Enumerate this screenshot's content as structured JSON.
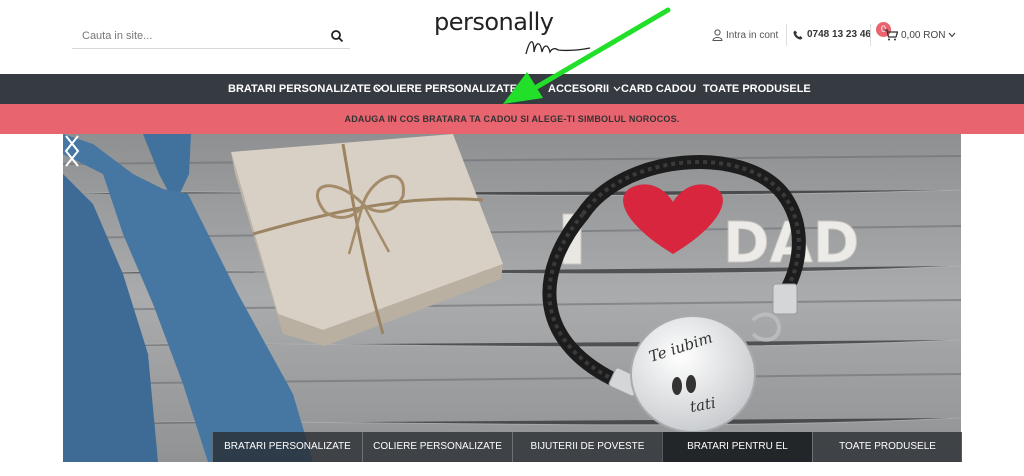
{
  "header": {
    "search_placeholder": "Cauta in site...",
    "logo_text": "personally",
    "account_label": "Intra in cont",
    "phone": "0748 13 23 46",
    "cart_count": "0",
    "cart_total": "0,00 RON"
  },
  "nav": {
    "items": [
      {
        "label": "BRATARI PERSONALIZATE",
        "dropdown": true
      },
      {
        "label": "COLIERE PERSONALIZATE",
        "dropdown": true
      },
      {
        "label": "ACCESORII",
        "dropdown": true
      },
      {
        "label": "CARD CADOU",
        "dropdown": false
      },
      {
        "label": "TOATE PRODUSELE",
        "dropdown": false
      }
    ]
  },
  "promo": {
    "text": "ADAUGA IN COS BRATARA TA CADOU SI ALEGE-TI SIMBOLUL NOROCOS."
  },
  "hero": {
    "sign_left": "I",
    "sign_right": "DAD",
    "charm_top": "Te iubim",
    "charm_bottom": "tati",
    "tabs": [
      {
        "label": "BRATARI PERSONALIZATE",
        "active": false
      },
      {
        "label": "COLIERE PERSONALIZATE",
        "active": false
      },
      {
        "label": "BIJUTERII DE POVESTE",
        "active": false
      },
      {
        "label": "BRATARI PENTRU EL",
        "active": true
      },
      {
        "label": "TOATE PRODUSELE",
        "active": false
      }
    ]
  },
  "colors": {
    "nav_bg": "#353b41",
    "promo_bg": "#e8646f",
    "annotation": "#22e02a",
    "heart": "#d7263d"
  },
  "icons": [
    "search-icon",
    "user-icon",
    "phone-icon",
    "cart-icon",
    "chevron-down-icon",
    "arrow-left-icon",
    "arrow-right-icon",
    "heart-icon"
  ]
}
